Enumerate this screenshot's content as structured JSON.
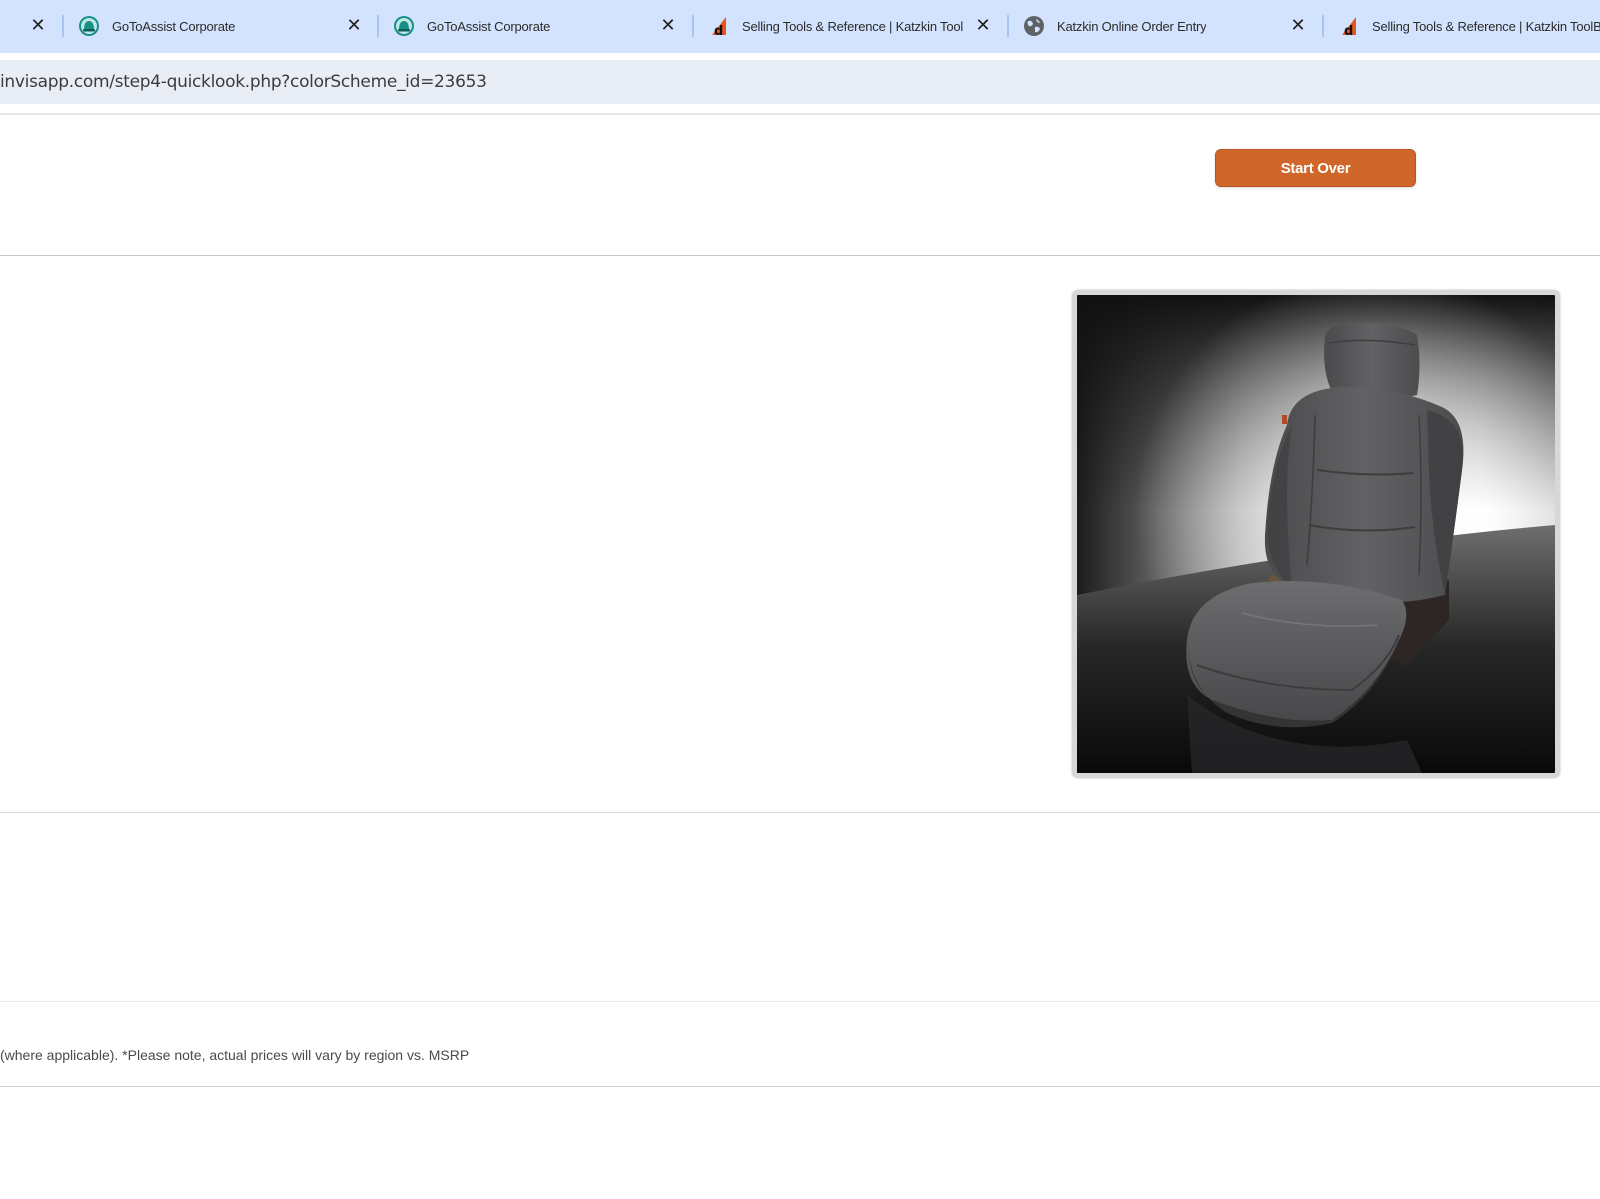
{
  "browser": {
    "tabs": [
      {
        "title": "GoToAssist Corporate",
        "icon": "gotoassist-icon"
      },
      {
        "title": "GoToAssist Corporate",
        "icon": "gotoassist-icon"
      },
      {
        "title": "Selling Tools & Reference | Katzkin ToolBo",
        "icon": "katzkin-icon"
      },
      {
        "title": "Katzkin Online Order Entry",
        "icon": "globe-icon"
      },
      {
        "title": "Selling Tools & Reference | Katzkin ToolBo",
        "icon": "katzkin-icon"
      }
    ],
    "close_glyph": "✕",
    "address": "invisapp.com/step4-quicklook.php?colorScheme_id=23653"
  },
  "page": {
    "start_over_label": "Start Over",
    "disclaimer": "(where applicable). *Please note, actual prices will vary by region vs. MSRP"
  },
  "colors": {
    "tabstrip_bg": "#d3e3fd",
    "omnibox_bg": "#e9eef6",
    "start_over_bg": "#d0662a",
    "seat_color": "#5c5c5e"
  }
}
